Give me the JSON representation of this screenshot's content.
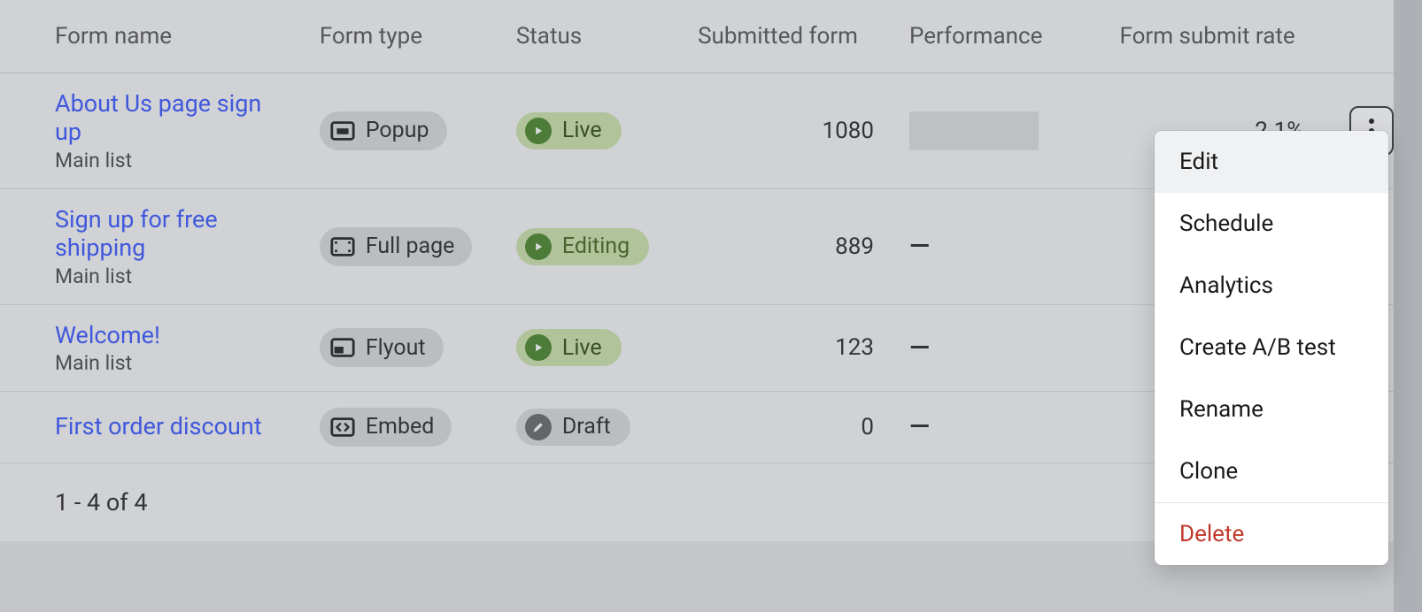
{
  "headers": {
    "name": "Form name",
    "type": "Form type",
    "status": "Status",
    "submitted": "Submitted form",
    "performance": "Performance",
    "rate": "Form submit rate"
  },
  "rows": [
    {
      "name": "About Us page sign up",
      "list": "Main list",
      "type": "Popup",
      "type_icon": "popup",
      "status": "Live",
      "status_kind": "live",
      "submitted": "1080",
      "performance": "block",
      "rate": "2.1%"
    },
    {
      "name": "Sign up for free shipping",
      "list": "Main list",
      "type": "Full page",
      "type_icon": "fullpage",
      "status": "Editing",
      "status_kind": "editing",
      "submitted": "889",
      "performance": "dash",
      "rate": ""
    },
    {
      "name": "Welcome!",
      "list": "Main list",
      "type": "Flyout",
      "type_icon": "flyout",
      "status": "Live",
      "status_kind": "live",
      "submitted": "123",
      "performance": "dash",
      "rate": ""
    },
    {
      "name": "First order discount",
      "list": "",
      "type": "Embed",
      "type_icon": "embed",
      "status": "Draft",
      "status_kind": "draft",
      "submitted": "0",
      "performance": "dash",
      "rate": ""
    }
  ],
  "footer": "1 - 4 of 4",
  "menu": {
    "edit": "Edit",
    "schedule": "Schedule",
    "analytics": "Analytics",
    "abtest": "Create A/B test",
    "rename": "Rename",
    "clone": "Clone",
    "delete": "Delete"
  }
}
